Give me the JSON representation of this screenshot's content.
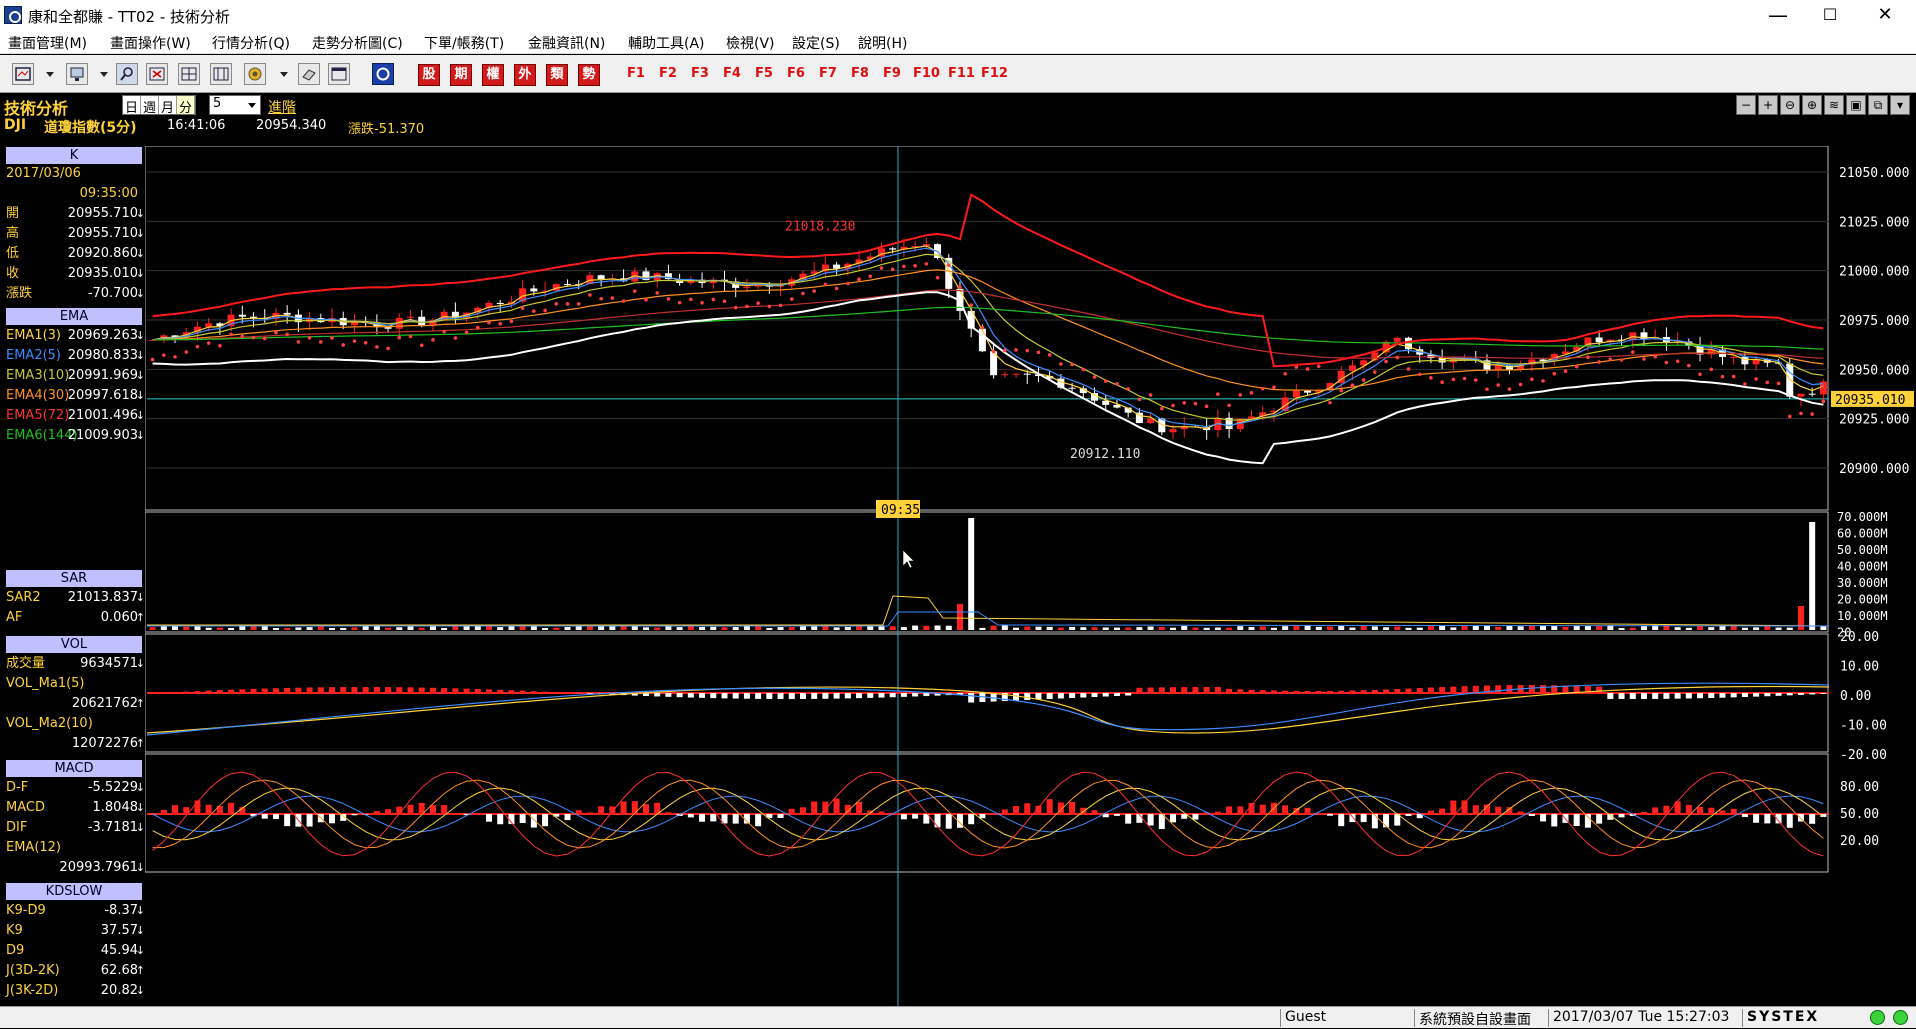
{
  "window": {
    "title": "康和全都賺 - TT02 - 技術分析",
    "min": "—",
    "max": "☐",
    "close": "✕"
  },
  "menu": [
    "畫面管理(M)",
    "畫面操作(W)",
    "行情分析(Q)",
    "走勢分析圖(C)",
    "下單/帳務(T)",
    "金融資訊(N)",
    "輔助工具(A)",
    "檢視(V)",
    "設定(S)",
    "說明(H)"
  ],
  "toolbar": {
    "icons": [
      "layout-icon",
      "screen-icon",
      "search-icon",
      "close-window-icon",
      "tile-icon",
      "split-icon",
      "globe-icon",
      "card-icon",
      "window-icon",
      "systex-icon"
    ],
    "category_buttons": [
      "股",
      "期",
      "權",
      "外",
      "類",
      "勢"
    ],
    "function_keys": [
      "F1",
      "F2",
      "F3",
      "F4",
      "F5",
      "F6",
      "F7",
      "F8",
      "F9",
      "F10",
      "F11",
      "F12"
    ]
  },
  "header": {
    "panel_title": "技術分析",
    "periods": [
      "日",
      "週",
      "月",
      "分"
    ],
    "active_period": "分",
    "interval_value": "5",
    "advanced_link": "進階",
    "symbol_code": "DJI",
    "symbol_name": "道瓊指數(5分)",
    "time": "16:41:06",
    "price": "20954.340",
    "change_label": "漲跌-51.370",
    "right_tools": [
      "−",
      "+",
      "⊖",
      "⊕",
      "≋",
      "▣",
      "⧉",
      "▾"
    ]
  },
  "panels": {
    "k": {
      "title": "K",
      "date": "2017/03/06",
      "time": "09:35:00",
      "rows": [
        {
          "label": "開",
          "value": "20955.710",
          "arrow": "↓"
        },
        {
          "label": "高",
          "value": "20955.710",
          "arrow": "↓"
        },
        {
          "label": "低",
          "value": "20920.860",
          "arrow": "↓"
        },
        {
          "label": "收",
          "value": "20935.010",
          "arrow": "↓"
        },
        {
          "label": "漲跌",
          "value": "-70.700",
          "arrow": "↓"
        }
      ]
    },
    "ema": {
      "title": "EMA",
      "rows": [
        {
          "label": "EMA1(3)",
          "value": "20969.263",
          "arrow": "↓",
          "color": "#ffd23a"
        },
        {
          "label": "EMA2(5)",
          "value": "20980.833",
          "arrow": "↓",
          "color": "#3c8cff"
        },
        {
          "label": "EMA3(10)",
          "value": "20991.969",
          "arrow": "↓",
          "color": "#c8c832"
        },
        {
          "label": "EMA4(30)",
          "value": "20997.618",
          "arrow": "↓",
          "color": "#ff9020"
        },
        {
          "label": "EMA5(72)",
          "value": "21001.496",
          "arrow": "↓",
          "color": "#ff3030"
        },
        {
          "label": "EMA6(144)",
          "value": "21009.903",
          "arrow": "↓",
          "color": "#20c020"
        }
      ]
    },
    "sar": {
      "title": "SAR",
      "rows": [
        {
          "label": "SAR2",
          "value": "21013.837",
          "arrow": "↓"
        },
        {
          "label": "AF",
          "value": "0.060",
          "arrow": "↑"
        }
      ]
    },
    "vol": {
      "title": "VOL",
      "rows": [
        {
          "label": "成交量",
          "value": "9634571",
          "arrow": "↓"
        },
        {
          "label": "VOL_Ma1(5)",
          "value": "",
          "arrow": ""
        },
        {
          "label": "",
          "value": "20621762",
          "arrow": "↑"
        },
        {
          "label": "VOL_Ma2(10)",
          "value": "",
          "arrow": ""
        },
        {
          "label": "",
          "value": "12072276",
          "arrow": "↑"
        }
      ]
    },
    "macd": {
      "title": "MACD",
      "rows": [
        {
          "label": "D-F",
          "value": "-5.5229",
          "arrow": "↓"
        },
        {
          "label": "MACD",
          "value": "1.8048",
          "arrow": "↓"
        },
        {
          "label": "DIF",
          "value": "-3.7181",
          "arrow": "↓"
        },
        {
          "label": "EMA(12)",
          "value": "",
          "arrow": ""
        },
        {
          "label": "",
          "value": "20993.7961",
          "arrow": "↓"
        }
      ]
    },
    "kd": {
      "title": "KDSLOW",
      "rows": [
        {
          "label": "K9-D9",
          "value": "-8.37",
          "arrow": "↓"
        },
        {
          "label": "K9",
          "value": "37.57",
          "arrow": "↓"
        },
        {
          "label": "D9",
          "value": "45.94",
          "arrow": "↓"
        },
        {
          "label": "J(3D-2K)",
          "value": "62.68",
          "arrow": "↑"
        },
        {
          "label": "J(3K-2D)",
          "value": "20.82",
          "arrow": "↓"
        }
      ]
    }
  },
  "chart": {
    "price_axis": [
      "21050.000",
      "21025.000",
      "21000.000",
      "20975.000",
      "20950.000",
      "20925.000",
      "20900.000"
    ],
    "current_price": "20935.010",
    "high_label": "21018.230",
    "low_label": "20912.110",
    "cursor_time": "09:35",
    "vol_axis": [
      "70.000M",
      "60.000M",
      "50.000M",
      "40.000M",
      "30.000M",
      "20.000M",
      "10.000M",
      "20"
    ],
    "macd_axis": [
      "20.00",
      "10.00",
      "0.00",
      "-10.00",
      "-20.00"
    ],
    "kd_axis": [
      "80.00",
      "50.00",
      "20.00"
    ]
  },
  "status": {
    "user": "Guest",
    "layout": "系統預設自設畫面",
    "datetime": "2017/03/07 Tue 15:27:03",
    "brand": "SYSTEX"
  }
}
